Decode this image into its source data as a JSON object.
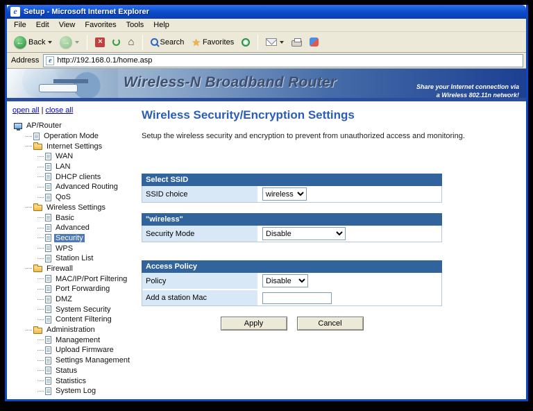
{
  "window": {
    "title": "Setup - Microsoft Internet Explorer"
  },
  "menu_bar": {
    "items": [
      "File",
      "Edit",
      "View",
      "Favorites",
      "Tools",
      "Help"
    ]
  },
  "toolbar": {
    "back": "Back",
    "search": "Search",
    "favorites": "Favorites"
  },
  "address_bar": {
    "label": "Address",
    "url": "http://192.168.0.1/home.asp"
  },
  "banner": {
    "title": "Wireless-N Broadband Router",
    "tagline_line1": "Share your Internet connection via",
    "tagline_line2": "a Wireless 802.11n network!"
  },
  "sidebar": {
    "open_all": "open all",
    "links_separator": "|",
    "close_all": "close all",
    "tree": [
      {
        "label": "AP/Router",
        "level": 0,
        "icon": "device"
      },
      {
        "label": "Operation Mode",
        "level": 1,
        "icon": "page"
      },
      {
        "label": "Internet Settings",
        "level": 1,
        "icon": "folder"
      },
      {
        "label": "WAN",
        "level": 2,
        "icon": "page"
      },
      {
        "label": "LAN",
        "level": 2,
        "icon": "page"
      },
      {
        "label": "DHCP clients",
        "level": 2,
        "icon": "page"
      },
      {
        "label": "Advanced Routing",
        "level": 2,
        "icon": "page"
      },
      {
        "label": "QoS",
        "level": 2,
        "icon": "page"
      },
      {
        "label": "Wireless Settings",
        "level": 1,
        "icon": "folder"
      },
      {
        "label": "Basic",
        "level": 2,
        "icon": "page"
      },
      {
        "label": "Advanced",
        "level": 2,
        "icon": "page"
      },
      {
        "label": "Security",
        "level": 2,
        "icon": "page",
        "selected": true
      },
      {
        "label": "WPS",
        "level": 2,
        "icon": "page"
      },
      {
        "label": "Station List",
        "level": 2,
        "icon": "page"
      },
      {
        "label": "Firewall",
        "level": 1,
        "icon": "folder"
      },
      {
        "label": "MAC/IP/Port Filtering",
        "level": 2,
        "icon": "page"
      },
      {
        "label": "Port Forwarding",
        "level": 2,
        "icon": "page"
      },
      {
        "label": "DMZ",
        "level": 2,
        "icon": "page"
      },
      {
        "label": "System Security",
        "level": 2,
        "icon": "page"
      },
      {
        "label": "Content Filtering",
        "level": 2,
        "icon": "page"
      },
      {
        "label": "Administration",
        "level": 1,
        "icon": "folder"
      },
      {
        "label": "Management",
        "level": 2,
        "icon": "page"
      },
      {
        "label": "Upload Firmware",
        "level": 2,
        "icon": "page"
      },
      {
        "label": "Settings Management",
        "level": 2,
        "icon": "page"
      },
      {
        "label": "Status",
        "level": 2,
        "icon": "page"
      },
      {
        "label": "Statistics",
        "level": 2,
        "icon": "page"
      },
      {
        "label": "System Log",
        "level": 2,
        "icon": "page"
      }
    ]
  },
  "main": {
    "title": "Wireless Security/Encryption Settings",
    "description": "Setup the wireless security and encryption to prevent from unauthorized access and monitoring.",
    "sections": [
      {
        "header": "Select SSID",
        "rows": [
          {
            "label": "SSID choice",
            "control": "select",
            "value": "wireless",
            "name": "ssid-choice"
          }
        ]
      },
      {
        "header": "\"wireless\"",
        "rows": [
          {
            "label": "Security Mode",
            "control": "select",
            "value": "Disable",
            "name": "security-mode"
          }
        ]
      },
      {
        "header": "Access Policy",
        "rows": [
          {
            "label": "Policy",
            "control": "select",
            "value": "Disable",
            "name": "policy"
          },
          {
            "label": "Add a station Mac",
            "control": "input",
            "value": "",
            "name": "station-mac"
          }
        ]
      }
    ],
    "buttons": {
      "apply": "Apply",
      "cancel": "Cancel"
    }
  },
  "colors": {
    "titlebar_blue": "#0B49C8",
    "banner_deep_blue": "#1C3F92",
    "section_header_blue": "#31639C",
    "label_cell_blue": "#D9E8F7",
    "page_title_blue": "#2A5DB8",
    "selected_node_blue": "#4E79B8"
  }
}
